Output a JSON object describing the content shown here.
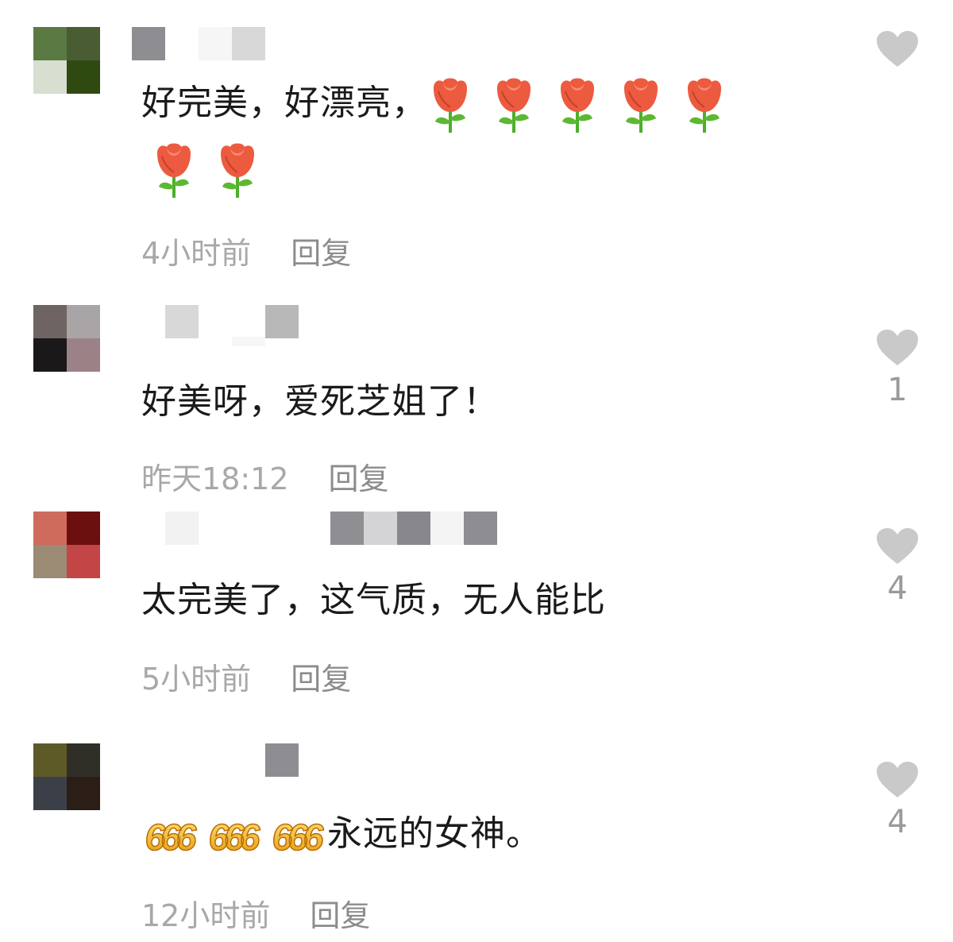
{
  "comments": [
    {
      "text": "好完美，好漂亮，",
      "emoji": [
        "rose-icon",
        "rose-icon",
        "rose-icon",
        "rose-icon",
        "rose-icon",
        "rose-icon",
        "rose-icon"
      ],
      "time": "4小时前",
      "reply_label": "回复",
      "like_count": "",
      "avatar_colors": [
        "#5b7a43",
        "#4a5d32",
        "#d6dfd0",
        "#2f4a10"
      ],
      "name_colors": [
        "#8e8e92",
        "#f6f6f6",
        "#d8d8d8"
      ]
    },
    {
      "text": "好美呀，爱死芝姐了！",
      "time": "昨天18:12",
      "reply_label": "回复",
      "like_count": "1",
      "avatar_colors": [
        "#6e6462",
        "#a9a5a7",
        "#1a1818",
        "#9c8286"
      ],
      "name_colors": [
        "#d8d8d8",
        "#f6f6f6",
        "#b8b8b8"
      ]
    },
    {
      "text": "太完美了，这气质，无人能比",
      "time": "5小时前",
      "reply_label": "回复",
      "like_count": "4",
      "avatar_colors": [
        "#cf6b5d",
        "#6c0f0f",
        "#9b8a74",
        "#c44545"
      ],
      "name_colors": [
        "#f2f2f2",
        "#8f8f93",
        "#d4d4d6",
        "#88888c",
        "#f4f4f4",
        "#8e8e92"
      ]
    },
    {
      "text": "永远的女神。",
      "prefix_emoji": "666-icon",
      "prefix_emoji_count": 3,
      "time": "12小时前",
      "reply_label": "回复",
      "like_count": "4",
      "avatar_colors": [
        "#5e5a28",
        "#2f2f28",
        "#3b4048",
        "#2a1e17"
      ],
      "name_colors": [
        "#8e8e92"
      ]
    }
  ],
  "colors": {
    "text": "#1a1a1a",
    "meta": "#a8a8a8",
    "reply": "#8c8c8c",
    "heart": "#c9c9c9",
    "count": "#9a9a9a"
  }
}
